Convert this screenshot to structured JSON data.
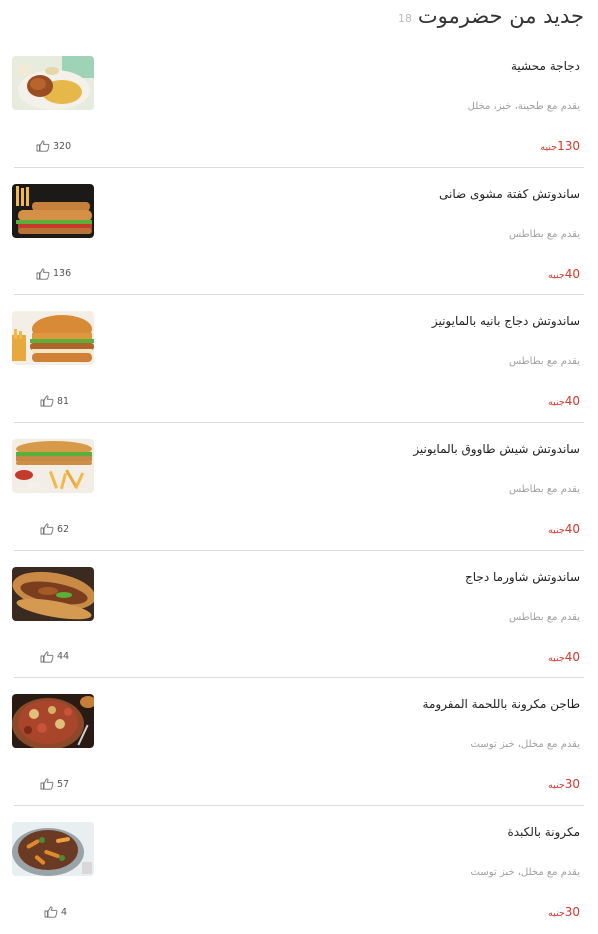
{
  "header": {
    "title": "جديد من حضرموت",
    "count": "18"
  },
  "items": [
    {
      "name": "دجاجة محشية",
      "desc": "يقدم مع طحينة، خبز، مخلل",
      "price": "130",
      "currency": "جنيه",
      "likes": "320",
      "image": "stuffed-chicken-plate"
    },
    {
      "name": "ساندوتش كفتة مشوى ضانى",
      "desc": "يقدم مع بطاطس",
      "price": "40",
      "currency": "جنيه",
      "likes": "136",
      "image": "kofta-sandwich"
    },
    {
      "name": "ساندوتش دجاج بانيه بالمايونيز",
      "desc": "يقدم مع بطاطس",
      "price": "40",
      "currency": "جنيه",
      "likes": "81",
      "image": "panne-chicken-burger"
    },
    {
      "name": "ساندوتش شيش طاووق بالمايونيز",
      "desc": "يقدم مع بطاطس",
      "price": "40",
      "currency": "جنيه",
      "likes": "62",
      "image": "shish-tawook-sandwich"
    },
    {
      "name": "ساندوتش شاورما دجاج",
      "desc": "يقدم مع بطاطس",
      "price": "40",
      "currency": "جنيه",
      "likes": "44",
      "image": "chicken-shawarma-sandwich"
    },
    {
      "name": "طاجن مكرونة باللحمة المفرومة",
      "desc": "يقدم مع مخلل، خبز توست",
      "price": "30",
      "currency": "جنيه",
      "likes": "57",
      "image": "minced-meat-pasta-tagine"
    },
    {
      "name": "مكرونة بالكبدة",
      "desc": "يقدم مع مخلل، خبز توست",
      "price": "30",
      "currency": "جنيه",
      "likes": "4",
      "image": "liver-pasta"
    }
  ],
  "colors": {
    "price": "#d33a2c",
    "muted": "#a0a0a0",
    "divider": "#dcdcdc"
  },
  "icons": {
    "like": "thumbs-up-icon"
  }
}
